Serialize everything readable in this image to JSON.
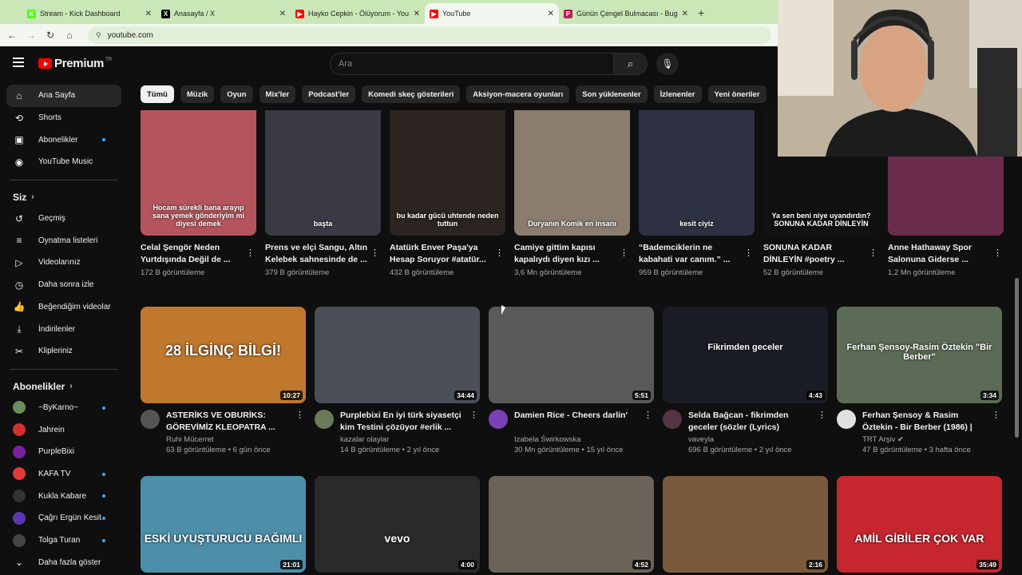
{
  "browser": {
    "tabs": [
      {
        "label": "Stream - Kick Dashboard",
        "icon": "kick-icon",
        "color": "#53fc18",
        "glyph": "K"
      },
      {
        "label": "Anasayfa / X",
        "icon": "x-icon",
        "color": "#000000",
        "glyph": "X"
      },
      {
        "label": "Hayko Cepkin - Ölüyorum - You",
        "icon": "youtube-icon",
        "color": "#ff0000",
        "glyph": "▶"
      },
      {
        "label": "YouTube",
        "icon": "youtube-icon",
        "color": "#ff0000",
        "glyph": "▶"
      },
      {
        "label": "Günün Çengel Bulmacası - Bug",
        "icon": "puzzle-icon",
        "color": "#c2185b",
        "glyph": "P"
      }
    ],
    "url": "youtube.com"
  },
  "header": {
    "brand": "Premium",
    "region": "TR",
    "search_placeholder": "Ara"
  },
  "sidebar": {
    "main": [
      {
        "label": "Ana Sayfa",
        "icon": "home-icon",
        "glyph": "⌂"
      },
      {
        "label": "Shorts",
        "icon": "shorts-icon",
        "glyph": "⟲"
      },
      {
        "label": "Abonelikler",
        "icon": "subscriptions-icon",
        "glyph": "▣"
      },
      {
        "label": "YouTube Music",
        "icon": "music-icon",
        "glyph": "◉"
      }
    ],
    "you_title": "Siz",
    "you": [
      {
        "label": "Geçmiş",
        "icon": "history-icon",
        "glyph": "↺"
      },
      {
        "label": "Oynatma listeleri",
        "icon": "playlists-icon",
        "glyph": "≡"
      },
      {
        "label": "Videolarınız",
        "icon": "your-videos-icon",
        "glyph": "▷"
      },
      {
        "label": "Daha sonra izle",
        "icon": "watch-later-icon",
        "glyph": "◷"
      },
      {
        "label": "Beğendiğim videolar",
        "icon": "liked-icon",
        "glyph": "👍"
      },
      {
        "label": "İndirilenler",
        "icon": "download-icon",
        "glyph": "⤓"
      },
      {
        "label": "Klipleriniz",
        "icon": "clips-icon",
        "glyph": "✂"
      }
    ],
    "subs_title": "Abonelikler",
    "subs": [
      {
        "label": "~ByKarno~",
        "color": "#6b8e5a"
      },
      {
        "label": "Jahrein",
        "color": "#d32f2f"
      },
      {
        "label": "PurpleBixi",
        "color": "#7b1fa2"
      },
      {
        "label": "KAFA TV",
        "color": "#e53935"
      },
      {
        "label": "Kukla Kabare",
        "color": "#333333"
      },
      {
        "label": "Çağrı Ergün Kesit",
        "color": "#5e35b1"
      },
      {
        "label": "Tolga Turan",
        "color": "#444444"
      }
    ],
    "more": "Daha fazla göster"
  },
  "chips": [
    "Tümü",
    "Müzik",
    "Oyun",
    "Mix'ler",
    "Podcast'ler",
    "Komedi skeç gösterileri",
    "Aksiyon-macera oyunları",
    "Son yüklenenler",
    "İzlenenler",
    "Yeni öneriler"
  ],
  "shorts": [
    {
      "title": "Celal Şengör Neden Yurtdışında Değil de ...",
      "views": "172 B görüntüleme",
      "bg": "#b4555e",
      "caption": "Hocam sürekli bana arayıp sana yemek gönderiyim mi diyesi demek"
    },
    {
      "title": "Prens ve elçi Sangu, Altın Kelebek sahnesinde de ...",
      "views": "379 B görüntüleme",
      "bg": "#3a3a44",
      "caption": "başta"
    },
    {
      "title": "Atatürk Enver Paşa'ya Hesap Soruyor  #atatür...",
      "views": "432 B görüntüleme",
      "bg": "#2b2420",
      "caption": "bu kadar gücü uhtende neden tuttun"
    },
    {
      "title": "Camiye gittim kapısı kapalıydı diyen kızı ...",
      "views": "3,6 Mn görüntüleme",
      "bg": "#8a7d70",
      "caption": "Duryanın Komik en insanı"
    },
    {
      "title": "“Bademciklerin ne kabahati var canım.” ...",
      "views": "959 B görüntüleme",
      "bg": "#2e3142",
      "caption": "kesit ciyiz"
    },
    {
      "title": "SONUNA KADAR DİNLEYİN #poetry ...",
      "views": "52 B görüntüleme",
      "bg": "#111111",
      "caption": "Ya sen beni niye uyandırdın? SONUNA KADAR DİNLEYİN"
    },
    {
      "title": "Anne Hathaway Spor Salonuna Giderse ...",
      "views": "1,2 Mn görüntüleme",
      "bg": "#6a2c4a",
      "caption": ""
    }
  ],
  "videos_row1": [
    {
      "title": "ASTERİKS VE OBURİKS: GÖREVİMİZ KLEOPATRA ...",
      "channel": "Ruhi Mücerret",
      "stats": "63 B görüntüleme • 6 gün önce",
      "duration": "10:27",
      "bg": "#c0782c",
      "av": "#555555",
      "overlay": "28 İLGİNÇ BİLGİ!"
    },
    {
      "title": "Purplebixi   En iyi türk siyasetçi kim  Testini çözüyor #erlik ...",
      "channel": "kazalar olaylar",
      "stats": "14 B görüntüleme • 2 yıl önce",
      "duration": "34:44",
      "bg": "#4a4f5a",
      "av": "#6b7a56",
      "overlay": ""
    },
    {
      "title": "Damien Rice - Cheers darlin'",
      "channel": "Izabela Świrkowska",
      "stats": "30 Mn görüntüleme • 15 yıl önce",
      "duration": "5:51",
      "bg": "#5a5a5a",
      "av": "#7b3fb5",
      "overlay": ""
    },
    {
      "title": "Selda Bağcan - fikrimden geceler (sözler (Lyrics)",
      "channel": "vaveyla",
      "stats": "696 B görüntüleme • 2 yıl önce",
      "duration": "4:43",
      "bg": "#1b1d26",
      "av": "#553344",
      "overlay": "Fikrimden geceler"
    },
    {
      "title": "Ferhan Şensoy & Rasim Öztekin - Bir Berber (1986) | TRT Arşiv",
      "channel": "TRT Arşiv ✔",
      "stats": "47 B görüntüleme • 3 hafta önce",
      "duration": "3:34",
      "bg": "#5b6b55",
      "av": "#e0e0e0",
      "overlay": "Ferhan Şensoy-Rasim Öztekin \"Bir Berber\""
    }
  ],
  "videos_row2": [
    {
      "duration": "21:01",
      "bg": "#4d8fa8",
      "overlay": "ESKİ UYUŞTURUCU BAĞIMLI"
    },
    {
      "duration": "4:00",
      "bg": "#2a2a2a",
      "overlay": "vevo"
    },
    {
      "duration": "4:52",
      "bg": "#6b6357",
      "overlay": ""
    },
    {
      "duration": "2:16",
      "bg": "#7a5a3c",
      "overlay": ""
    },
    {
      "duration": "35:49",
      "bg": "#c6262e",
      "overlay": "AMİL GİBİLER ÇOK VAR"
    }
  ]
}
